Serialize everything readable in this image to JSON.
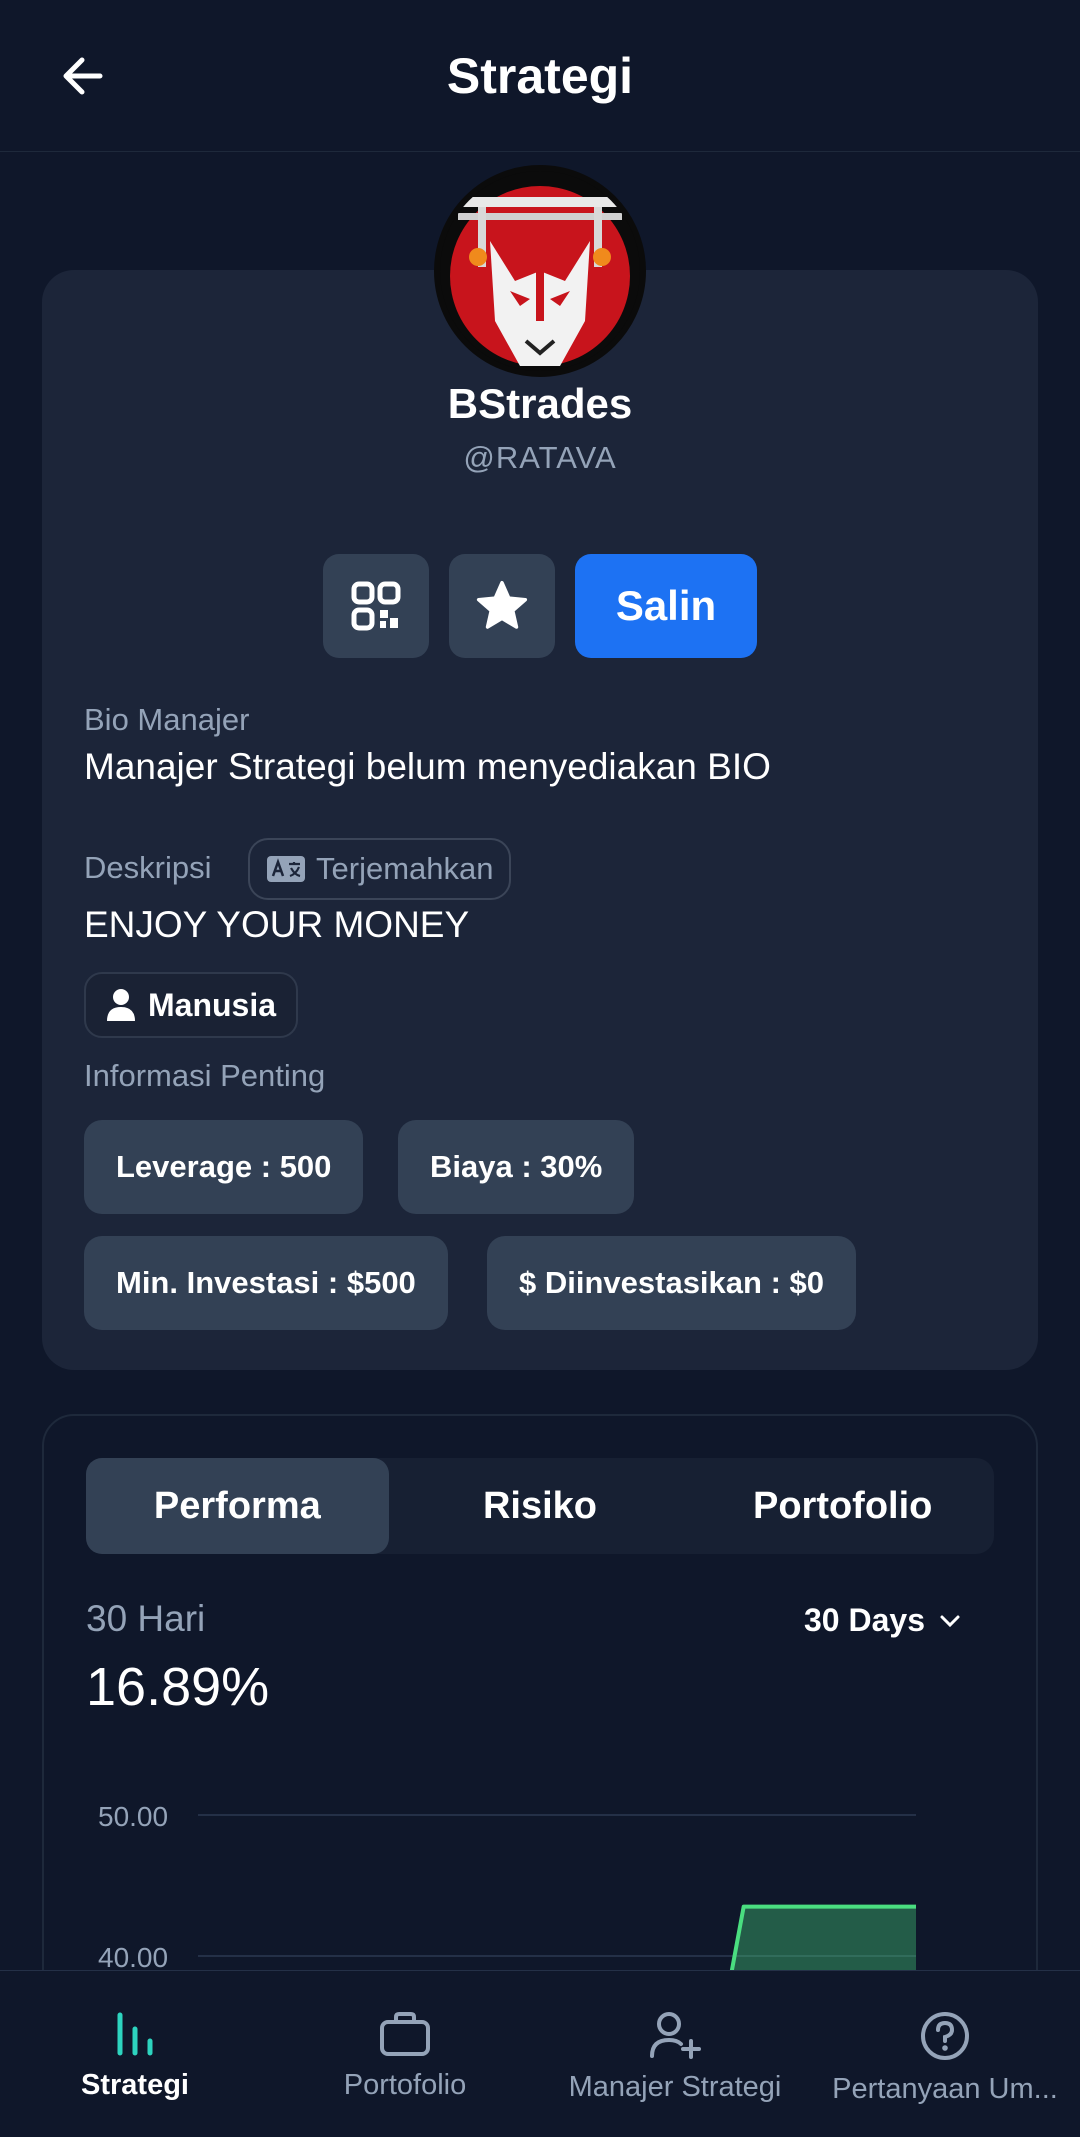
{
  "header": {
    "title": "Strategi"
  },
  "profile": {
    "name": "BStrades",
    "handle": "@RATAVA",
    "copy_label": "Salin",
    "bio_label": "Bio Manajer",
    "bio_text": "Manajer Strategi belum menyediakan BIO",
    "desc_label": "Deskripsi",
    "translate_label": "Terjemahkan",
    "desc_text": "ENJOY YOUR MONEY",
    "type_badge": "Manusia",
    "info_label": "Informasi Penting",
    "info_chips": [
      "Leverage : 500",
      "Biaya : 30%",
      "Min. Investasi : $500",
      "$ Diinvestasikan : $0"
    ]
  },
  "performance": {
    "tabs": [
      "Performa",
      "Risiko",
      "Portofolio"
    ],
    "active_tab": "Performa",
    "period_label": "30 Hari",
    "period_value": "16.89%",
    "period_select": "30 Days"
  },
  "chart_data": {
    "type": "area",
    "y_ticks": [
      "50.00",
      "40.00"
    ],
    "ylim": [
      38,
      52
    ],
    "color": "#4ade80",
    "x": [
      0,
      0.74,
      0.76,
      1.0
    ],
    "values": [
      null,
      38,
      43.5,
      43.5
    ]
  },
  "nav": {
    "items": [
      {
        "label": "Strategi",
        "icon": "bar-chart-icon"
      },
      {
        "label": "Portofolio",
        "icon": "briefcase-icon"
      },
      {
        "label": "Manajer Strategi",
        "icon": "user-plus-icon"
      },
      {
        "label": "Pertanyaan Um...",
        "icon": "help-circle-icon"
      }
    ]
  },
  "colors": {
    "background": "#0f172a",
    "card": "#1c2539",
    "accent": "#1d72f3",
    "chart": "#4ade80"
  }
}
